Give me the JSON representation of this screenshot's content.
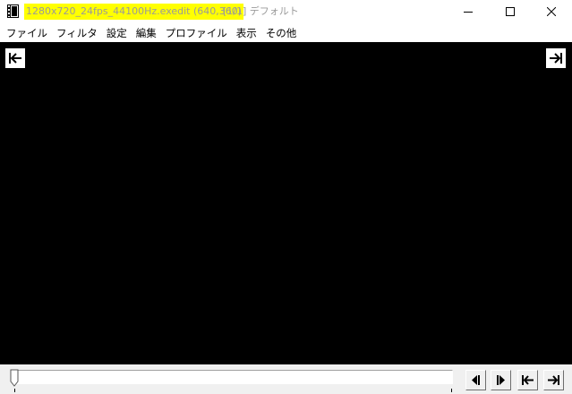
{
  "window": {
    "title_highlighted": "1280x720_24fps_44100Hz.exedit (640,360)",
    "title_rest": "[1/1]  デフォルト"
  },
  "icons": {
    "app": "filmstrip-icon",
    "minimize": "minimize-icon",
    "maximize": "maximize-icon",
    "close": "close-icon"
  },
  "menu": {
    "items": [
      "ファイル",
      "フィルタ",
      "設定",
      "編集",
      "プロファイル",
      "表示",
      "その他"
    ]
  },
  "colors": {
    "title_highlight": "#ffff00",
    "canvas": "#000000"
  },
  "seekbar": {
    "position": 0
  }
}
